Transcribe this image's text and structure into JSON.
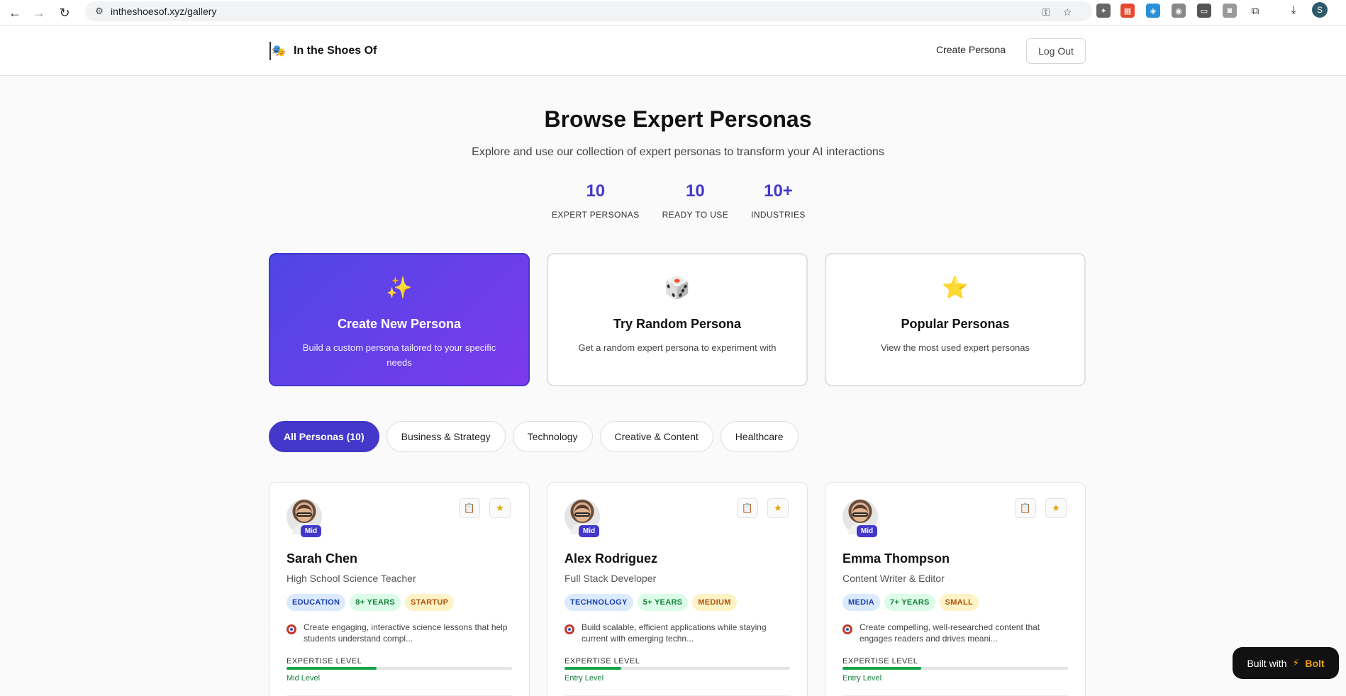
{
  "browser": {
    "url": "intheshoesof.xyz/gallery",
    "profile_initial": "S"
  },
  "header": {
    "brand": "In the Shoes Of",
    "create_link": "Create Persona",
    "logout": "Log Out"
  },
  "hero": {
    "title": "Browse Expert Personas",
    "subtitle": "Explore and use our collection of expert personas to transform your AI interactions",
    "stats": [
      {
        "value": "10",
        "label": "EXPERT PERSONAS"
      },
      {
        "value": "10",
        "label": "READY TO USE"
      },
      {
        "value": "10+",
        "label": "INDUSTRIES"
      }
    ]
  },
  "actions": [
    {
      "icon": "✨",
      "title": "Create New Persona",
      "desc": "Build a custom persona tailored to your specific needs"
    },
    {
      "icon": "🎲",
      "title": "Try Random Persona",
      "desc": "Get a random expert persona to experiment with"
    },
    {
      "icon": "⭐",
      "title": "Popular Personas",
      "desc": "View the most used expert personas"
    }
  ],
  "filters": [
    "All Personas (10)",
    "Business & Strategy",
    "Technology",
    "Creative & Content",
    "Healthcare"
  ],
  "personas": [
    {
      "level_badge": "Mid",
      "name": "Sarah Chen",
      "role": "High School Science Teacher",
      "tags": {
        "industry": "EDUCATION",
        "years": "8+ YEARS",
        "size": "STARTUP"
      },
      "goal": "Create engaging, interactive science lessons that help students understand compl...",
      "expertise_label": "EXPERTISE LEVEL",
      "expertise_level": "Mid Level",
      "expertise_fraction": 0.4
    },
    {
      "level_badge": "Mid",
      "name": "Alex Rodriguez",
      "role": "Full Stack Developer",
      "tags": {
        "industry": "TECHNOLOGY",
        "years": "5+ YEARS",
        "size": "MEDIUM"
      },
      "goal": "Build scalable, efficient applications while staying current with emerging techn...",
      "expertise_label": "EXPERTISE LEVEL",
      "expertise_level": "Entry Level",
      "expertise_fraction": 0.25
    },
    {
      "level_badge": "Mid",
      "name": "Emma Thompson",
      "role": "Content Writer & Editor",
      "tags": {
        "industry": "MEDIA",
        "years": "7+ YEARS",
        "size": "SMALL"
      },
      "goal": "Create compelling, well-researched content that engages readers and drives meani...",
      "expertise_label": "EXPERTISE LEVEL",
      "expertise_level": "Entry Level",
      "expertise_fraction": 0.35
    }
  ],
  "bolt": {
    "prefix": "Built with",
    "name": "Bolt"
  }
}
